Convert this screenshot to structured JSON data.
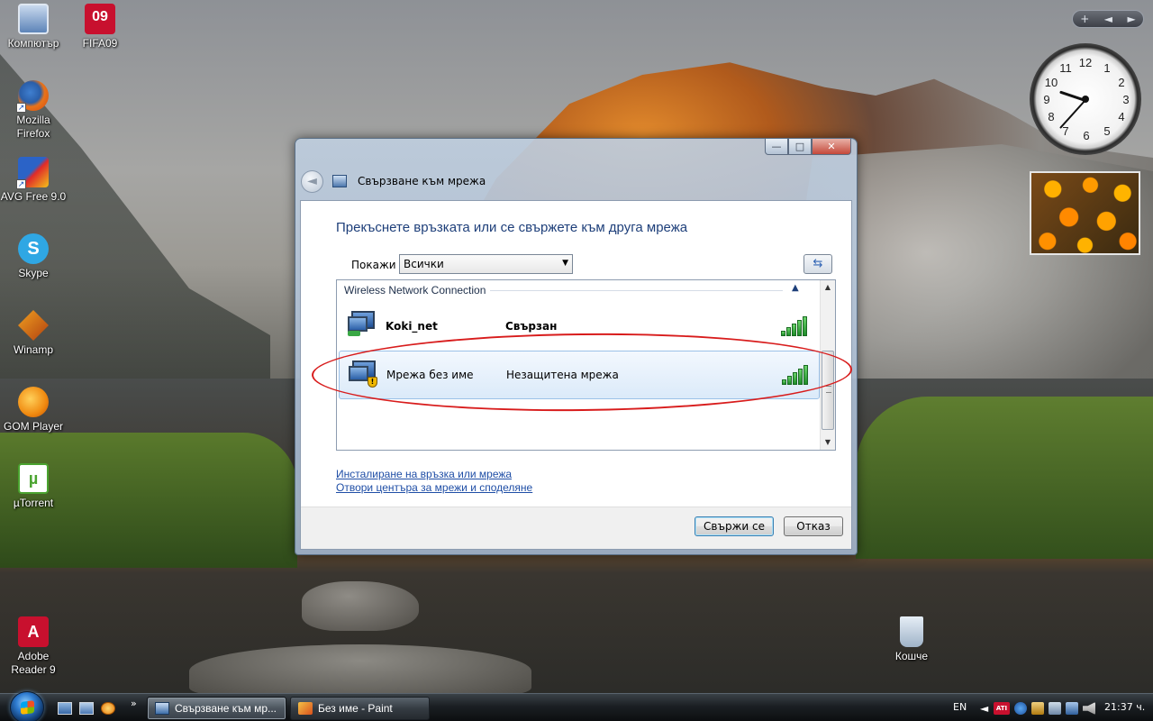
{
  "desktop": {
    "icons": [
      {
        "label": "Компютър",
        "icon": "computer-icon"
      },
      {
        "label": "FIFA09",
        "icon": "fifa-icon",
        "glyph": "09"
      },
      {
        "label": "Mozilla Firefox",
        "icon": "firefox-icon"
      },
      {
        "label": "AVG Free 9.0",
        "icon": "avg-icon"
      },
      {
        "label": "Skype",
        "icon": "skype-icon",
        "glyph": "S"
      },
      {
        "label": "Winamp",
        "icon": "winamp-icon"
      },
      {
        "label": "GOM Player",
        "icon": "gom-player-icon"
      },
      {
        "label": "µTorrent",
        "icon": "utorrent-icon",
        "glyph": "µ"
      },
      {
        "label": "Adobe Reader 9",
        "icon": "adobe-reader-icon",
        "glyph": "A"
      },
      {
        "label": "Кошче",
        "icon": "recycle-bin-icon"
      }
    ],
    "shortcut_arrow": "↗"
  },
  "gadgets": {
    "bar": {
      "add": "+",
      "prev": "◄",
      "next": "►"
    },
    "clock": {
      "numbers": [
        "12",
        "1",
        "2",
        "3",
        "4",
        "5",
        "6",
        "7",
        "8",
        "9",
        "10",
        "11"
      ],
      "time_shown": "21:37"
    },
    "slideshow": {
      "subject": "orange flowers photo"
    }
  },
  "window": {
    "title": "Свързване към мрежа",
    "caption_buttons": {
      "minimize": "—",
      "maximize": "□",
      "close": "✕"
    },
    "back_glyph": "◄",
    "heading": "Прекъснете връзката или се свържете към друга мрежа",
    "filter": {
      "label": "Покажи",
      "selected": "Всички",
      "arrow": "▼"
    },
    "refresh_glyph": "⇆",
    "list": {
      "group": "Wireless Network Connection",
      "collapse_glyph": "▲",
      "scroll_up": "▲",
      "scroll_down": "▼",
      "networks": [
        {
          "name": "Koki_net",
          "status": "Свързан",
          "signal_bars": 5,
          "secured": true,
          "selected": false
        },
        {
          "name": "Мрежа без име",
          "status": "Незащитена мрежа",
          "signal_bars": 5,
          "secured": false,
          "selected": true
        }
      ]
    },
    "links": {
      "setup": "Инсталиране на връзка или мрежа",
      "center": "Отвори центъра за мрежи и споделяне"
    },
    "buttons": {
      "connect": "Свържи се",
      "cancel": "Отказ"
    }
  },
  "annotation": {
    "color": "#d81c1c"
  },
  "taskbar": {
    "quick_launch_more": "»",
    "tasks": [
      {
        "label": "Свързване към мр...",
        "active": true
      },
      {
        "label": "Без име - Paint",
        "active": false
      }
    ],
    "tray": {
      "language": "EN",
      "chevron": "◄",
      "ati": "ATI",
      "clock": "21:37 ч."
    }
  }
}
